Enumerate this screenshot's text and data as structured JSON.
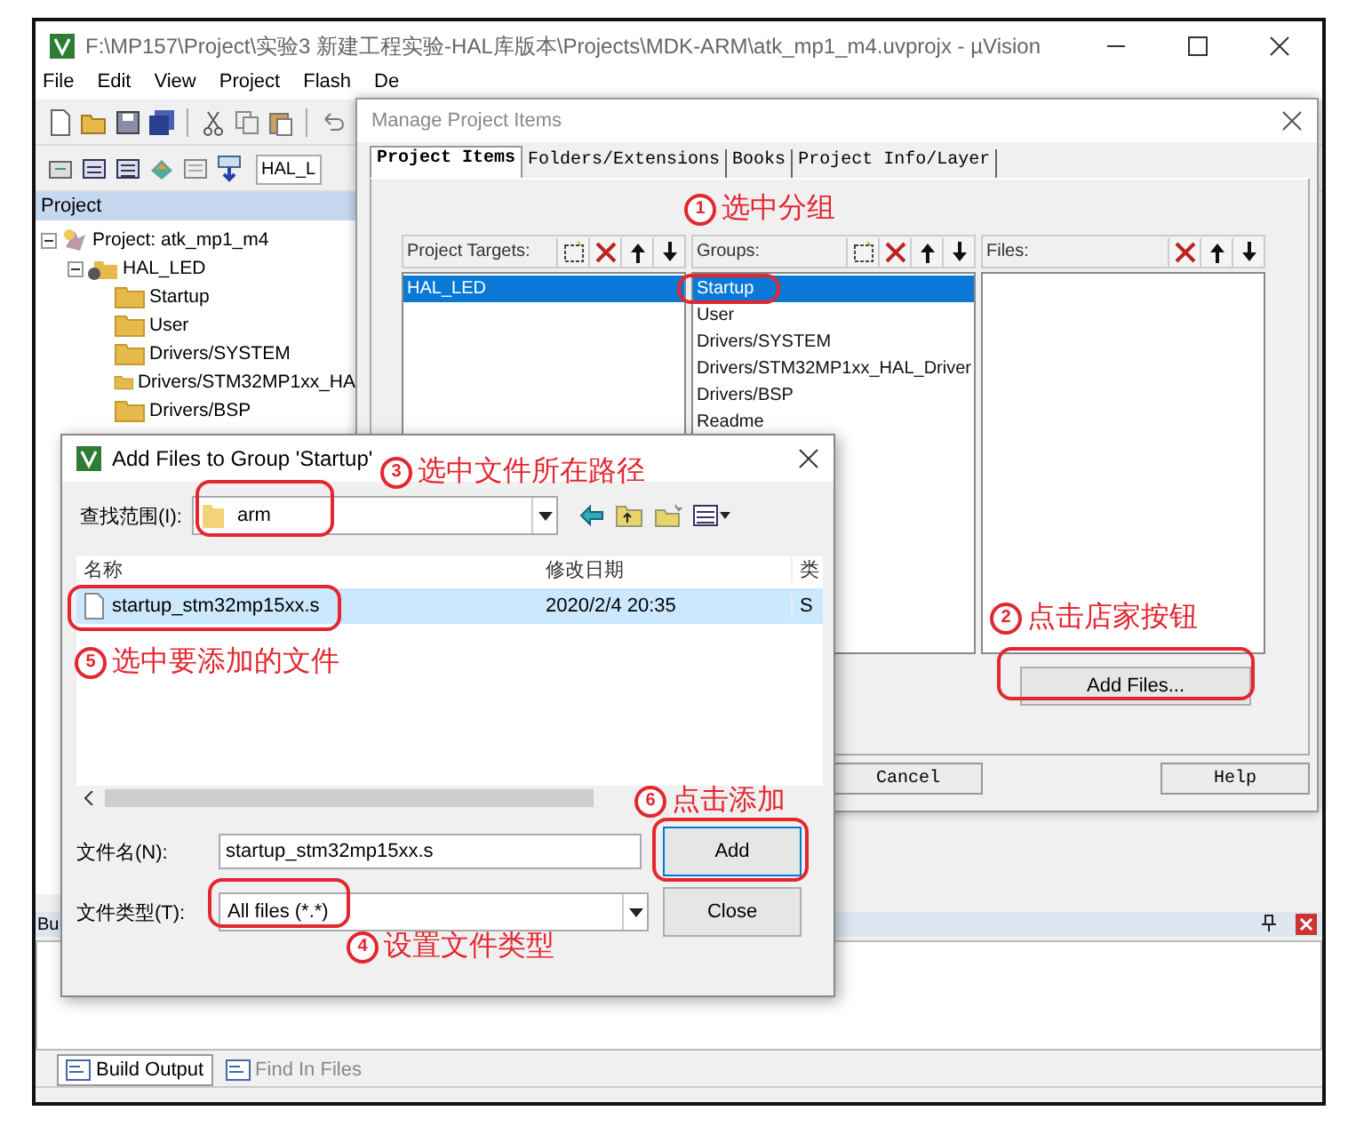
{
  "main_window": {
    "title": "F:\\MP157\\Project\\实验3 新建工程实验-HAL库版本\\Projects\\MDK-ARM\\atk_mp1_m4.uvprojx - µVision",
    "menu": [
      "File",
      "Edit",
      "View",
      "Project",
      "Flash",
      "De"
    ],
    "target_select": "HAL_L",
    "project_pane": {
      "title": "Project",
      "tree": [
        {
          "label": "Project: atk_mp1_m4",
          "kind": "project",
          "expanded": true,
          "children": [
            {
              "label": "HAL_LED",
              "kind": "target",
              "expanded": true,
              "children": [
                {
                  "label": "Startup",
                  "kind": "group"
                },
                {
                  "label": "User",
                  "kind": "group"
                },
                {
                  "label": "Drivers/SYSTEM",
                  "kind": "group"
                },
                {
                  "label": "Drivers/STM32MP1xx_HA",
                  "kind": "group"
                },
                {
                  "label": "Drivers/BSP",
                  "kind": "group"
                }
              ]
            }
          ]
        }
      ]
    },
    "output_pane": {
      "title": "Bu"
    },
    "output_tabs": [
      {
        "label": "Build Output",
        "selected": true
      },
      {
        "label": "Find In Files",
        "selected": false
      }
    ]
  },
  "manage_dialog": {
    "title": "Manage Project Items",
    "tabs": [
      {
        "label": "Project Items",
        "selected": true
      },
      {
        "label": "Folders/Extensions",
        "selected": false
      },
      {
        "label": "Books",
        "selected": false
      },
      {
        "label": "Project Info/Layer",
        "selected": false
      }
    ],
    "columns": [
      {
        "title": "Project Targets:",
        "tools": [
          {
            "kind": "new"
          },
          {
            "kind": "delete"
          },
          {
            "kind": "up"
          },
          {
            "kind": "down"
          }
        ],
        "items": [
          {
            "label": "HAL_LED",
            "selected": true
          }
        ]
      },
      {
        "title": "Groups:",
        "tools": [
          {
            "kind": "new"
          },
          {
            "kind": "delete"
          },
          {
            "kind": "up"
          },
          {
            "kind": "down"
          }
        ],
        "items": [
          {
            "label": "Startup",
            "selected": true
          },
          {
            "label": "User",
            "selected": false
          },
          {
            "label": "Drivers/SYSTEM",
            "selected": false
          },
          {
            "label": "Drivers/STM32MP1xx_HAL_Driver",
            "selected": false
          },
          {
            "label": "Drivers/BSP",
            "selected": false
          },
          {
            "label": "Readme",
            "selected": false
          }
        ]
      },
      {
        "title": "Files:",
        "tools": [
          {
            "kind": "delete"
          },
          {
            "kind": "up"
          },
          {
            "kind": "down"
          }
        ]
      }
    ],
    "add_files_button": "Add Files...",
    "buttons": [
      "Cancel",
      "Help"
    ]
  },
  "add_dialog": {
    "title": "Add Files to Group 'Startup'",
    "look_in_label": "查找范围(I):",
    "look_in_value": "arm",
    "columns": [
      "名称",
      "修改日期",
      "类"
    ],
    "files": [
      {
        "name": "startup_stm32mp15xx.s",
        "date": "2020/2/4 20:35",
        "type": "S",
        "selected": true
      }
    ],
    "filename_label": "文件名(N):",
    "filename_value": "startup_stm32mp15xx.s",
    "filetype_label": "文件类型(T):",
    "filetype_value": "All files (*.*)",
    "buttons": [
      "Add",
      "Close"
    ]
  },
  "annotations": [
    {
      "number": "1",
      "text": "选中分组"
    },
    {
      "number": "2",
      "text": "点击店家按钮"
    },
    {
      "number": "3",
      "text": "选中文件所在路径"
    },
    {
      "number": "4",
      "text": "设置文件类型"
    },
    {
      "number": "5",
      "text": "选中要添加的文件"
    },
    {
      "number": "6",
      "text": "点击添加"
    }
  ]
}
